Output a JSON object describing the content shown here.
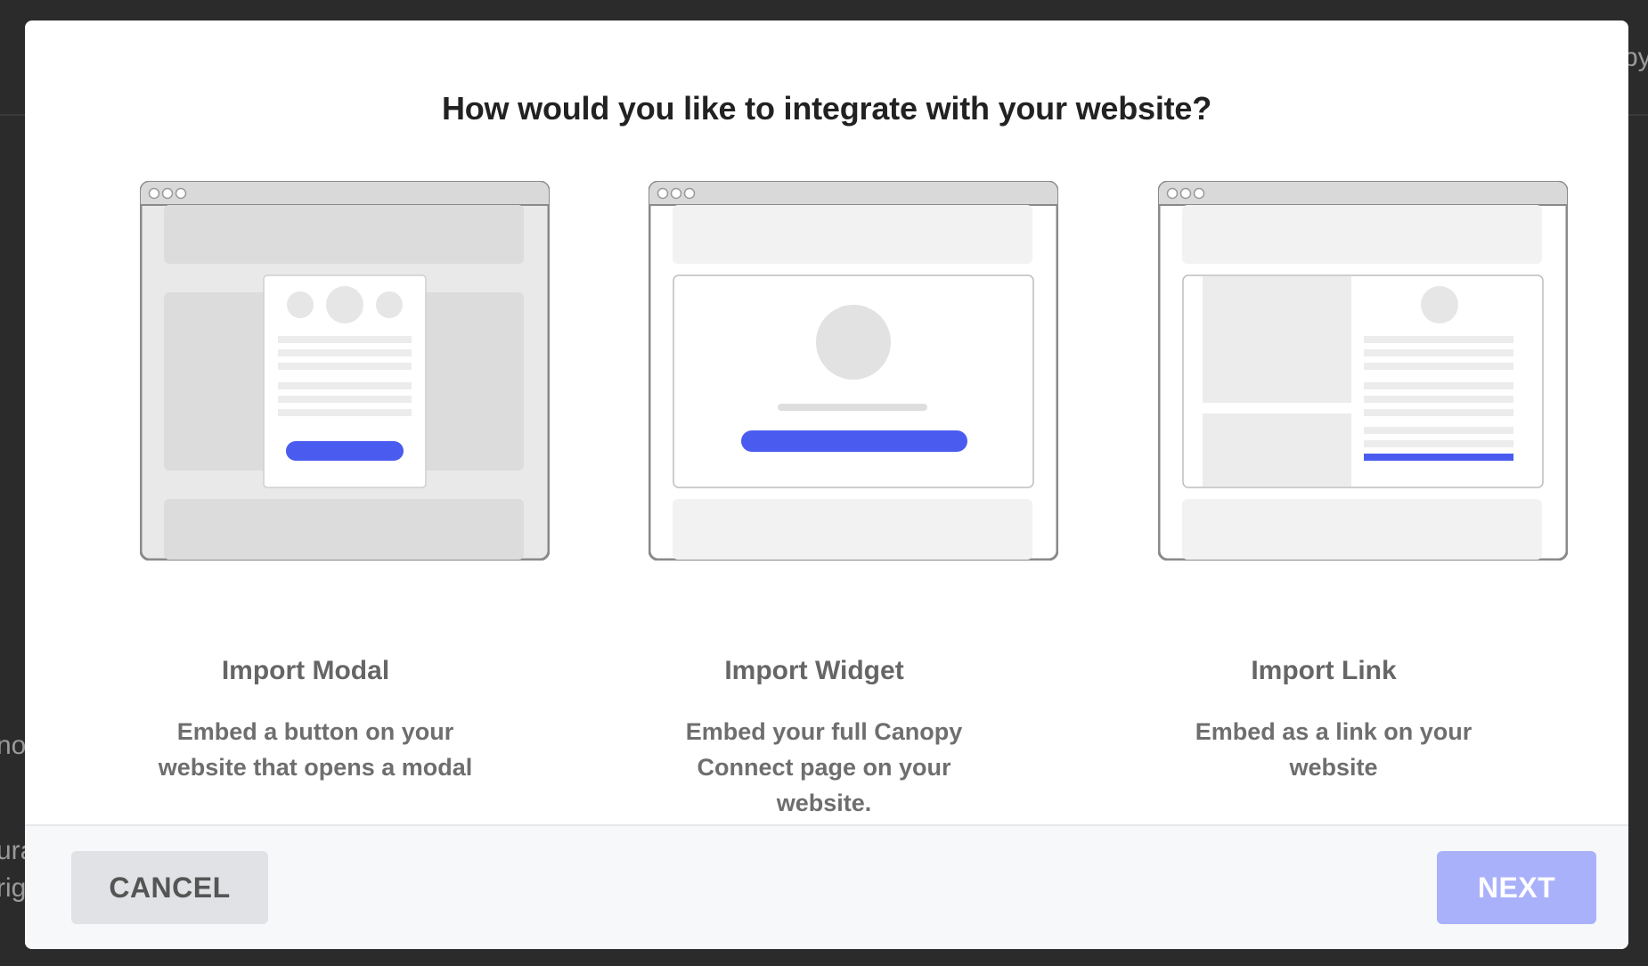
{
  "modal": {
    "title": "How would you like to integrate with your website?"
  },
  "options": [
    {
      "title": "Import Modal",
      "description": "Embed a button on your website that opens a modal",
      "illustration": "browser-with-modal"
    },
    {
      "title": "Import Widget",
      "description": "Embed your full Canopy Connect page on your website.",
      "illustration": "browser-with-widget"
    },
    {
      "title": "Import Link",
      "description": "Embed as a link on your website",
      "illustration": "browser-with-link-page"
    }
  ],
  "footer": {
    "cancel_label": "CANCEL",
    "next_label": "NEXT"
  },
  "background": {
    "fragment_right": "py.",
    "fragment_left_1": "no",
    "fragment_left_2": "ura",
    "fragment_left_3": "rig"
  },
  "colors": {
    "accent": "#4a5cf0",
    "next_disabled": "#aab1fb",
    "placeholder_gray": "#dcdcdc",
    "frame_border": "#8a8a8a"
  }
}
